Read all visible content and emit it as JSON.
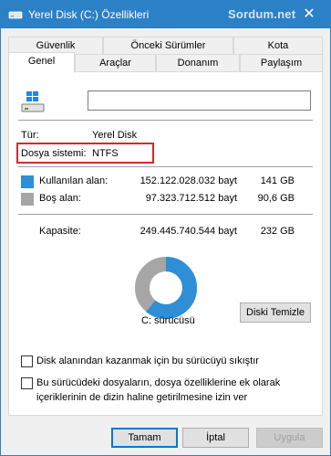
{
  "window": {
    "title": "Yerel Disk (C:) Özellikleri",
    "watermark": "Sordum.net",
    "close_glyph": "✕"
  },
  "tabs": {
    "row1": [
      {
        "label": "Güvenlik"
      },
      {
        "label": "Önceki Sürümler"
      },
      {
        "label": "Kota"
      }
    ],
    "row2": [
      {
        "label": "Genel",
        "active": true
      },
      {
        "label": "Araçlar"
      },
      {
        "label": "Donanım"
      },
      {
        "label": "Paylaşım"
      }
    ]
  },
  "general": {
    "drive_icon": "windows-drive-icon",
    "name_value": "",
    "type_label": "Tür:",
    "type_value": "Yerel Disk",
    "fs_label": "Dosya sistemi:",
    "fs_value": "NTFS",
    "used_label": "Kullanılan alan:",
    "used_bytes": "152.122.028.032 bayt",
    "used_gb": "141 GB",
    "free_label": "Boş alan:",
    "free_bytes": "97.323.712.512 bayt",
    "free_gb": "90,6 GB",
    "capacity_label": "Kapasite:",
    "capacity_bytes": "249.445.740.544 bayt",
    "capacity_gb": "232 GB",
    "drive_label": "C: sürücüsü",
    "cleanup_button": "Diski Temizle",
    "compress_label": "Disk alanından kazanmak için bu sürücüyü sıkıştır",
    "compress_checked": false,
    "index_label_line1": "Bu sürücüdeki dosyaların, dosya özelliklerine ek olarak",
    "index_label_line2": "içeriklerinin de dizin haline getirilmesine izin ver",
    "index_checked": false
  },
  "usage_ring": {
    "used_fraction": 0.61,
    "used_color": "#2e8fd6",
    "free_color": "#a6a6a6"
  },
  "buttons": {
    "ok": "Tamam",
    "cancel": "İptal",
    "apply": "Uygula"
  },
  "colors": {
    "titlebar": "#2b80c6",
    "highlight_border": "#cf2a2a"
  }
}
